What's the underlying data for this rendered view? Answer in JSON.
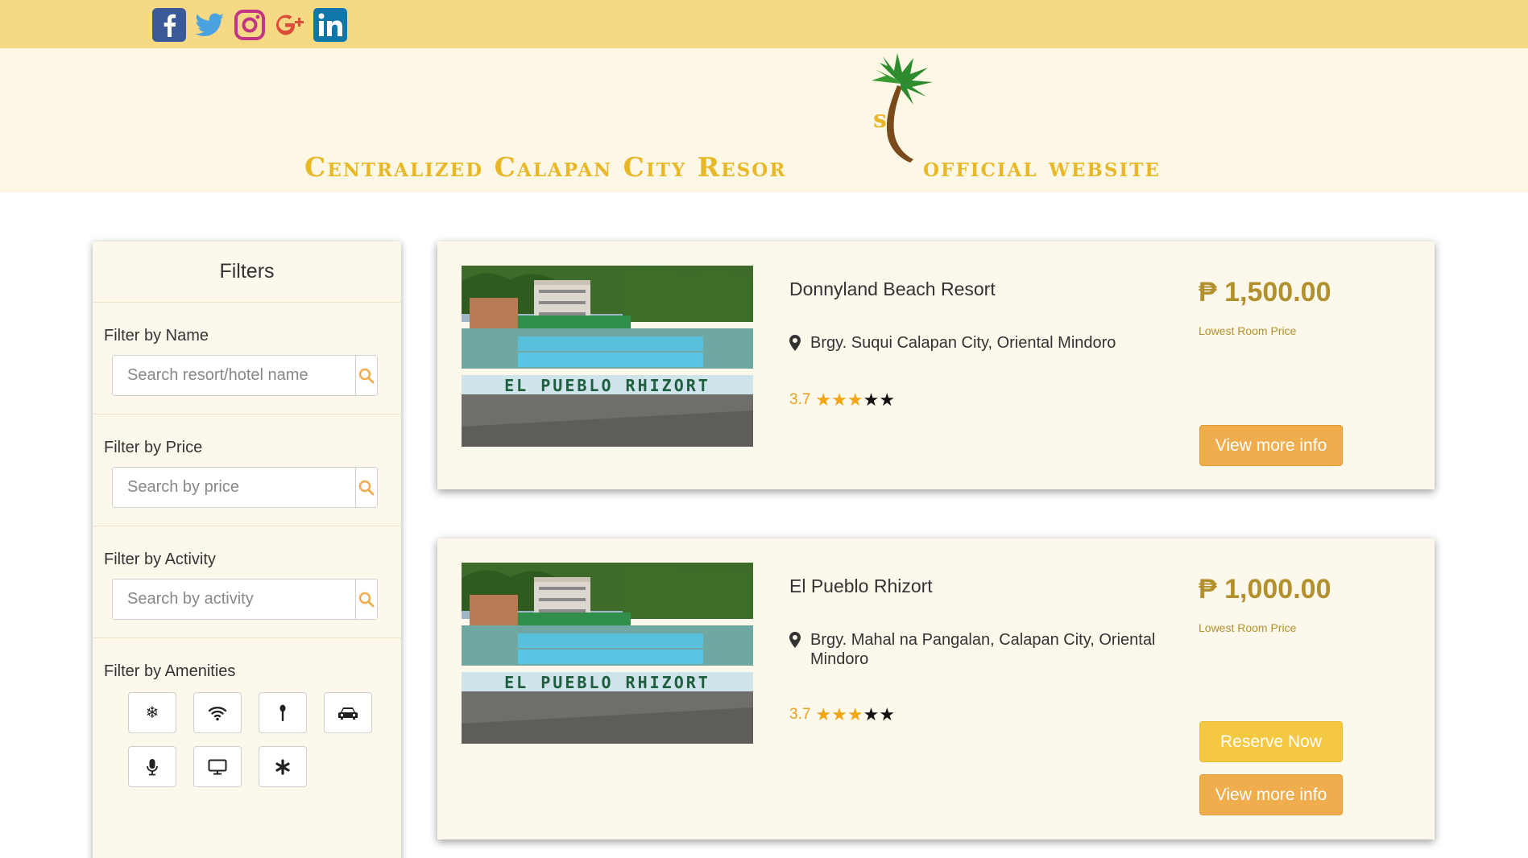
{
  "social": [
    {
      "name": "facebook-icon",
      "color": "#3b5998"
    },
    {
      "name": "twitter-icon",
      "color": "#4aa3df"
    },
    {
      "name": "instagram-icon",
      "color": "#c13584"
    },
    {
      "name": "google-plus-icon",
      "color": "#dd4b39"
    },
    {
      "name": "linkedin-icon",
      "color": "#0e76a8"
    }
  ],
  "header": {
    "title_left": "Centralized Calapan City Resor",
    "title_right": "official website"
  },
  "sidebar": {
    "title": "Filters",
    "name_filter": {
      "label": "Filter by Name",
      "placeholder": "Search resort/hotel name"
    },
    "price_filter": {
      "label": "Filter by Price",
      "placeholder": "Search by price"
    },
    "activity_filter": {
      "label": "Filter by Activity",
      "placeholder": "Search by activity"
    },
    "amenities": {
      "label": "Filter by Amenities",
      "items": [
        "snowflake-icon",
        "wifi-icon",
        "torch-icon",
        "car-icon",
        "microphone-icon",
        "tv-icon",
        "asterisk-icon"
      ]
    }
  },
  "listings": [
    {
      "name": "Donnyland Beach Resort",
      "address": "Brgy. Suqui Calapan City, Oriental Mindoro",
      "rating": "3.7",
      "stars_filled": 3,
      "stars_total": 5,
      "price": "₱ 1,500.00",
      "price_note": "Lowest Room Price",
      "info_label": "View more info"
    },
    {
      "name": "El Pueblo Rhizort",
      "address": "Brgy. Mahal na Pangalan, Calapan City, Oriental Mindoro",
      "rating": "3.7",
      "stars_filled": 3,
      "stars_total": 5,
      "price": "₱ 1,000.00",
      "price_note": "Lowest Room Price",
      "reserve_label": "Reserve Now",
      "info_label": "View more info"
    }
  ],
  "photo_sign": "EL PUEBLO RHIZORT",
  "colors": {
    "topbar": "#f5d984",
    "banner": "#fdf8e6",
    "brand": "#e8b828",
    "price": "#b3902e",
    "info_button": "#f0ad4e",
    "reserve_button": "#f5c842"
  }
}
